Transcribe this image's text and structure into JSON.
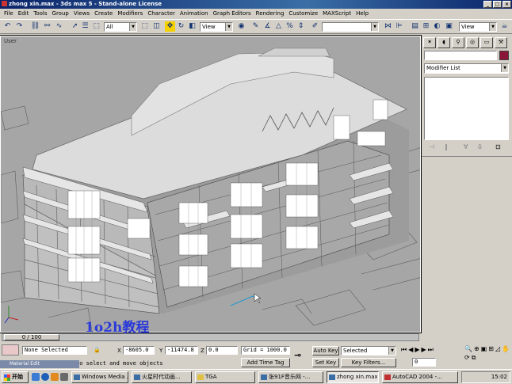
{
  "window": {
    "title": "zhong xin.max - 3ds max 5 - Stand-alone License"
  },
  "menu": [
    "File",
    "Edit",
    "Tools",
    "Group",
    "Views",
    "Create",
    "Modifiers",
    "Character",
    "Animation",
    "Graph Editors",
    "Rendering",
    "Customize",
    "MAXScript",
    "Help"
  ],
  "toolbar": {
    "selection_filter": "All",
    "ref_coord": "View",
    "named_selection": "",
    "ref_coord_right": "View"
  },
  "viewport": {
    "label": "User",
    "watermark": "1o2h教程"
  },
  "command_panel": {
    "modifier_list": "Modifier List",
    "name_field": "",
    "color": "#8b1538"
  },
  "timeslider": {
    "frame_text": "0 / 100"
  },
  "status": {
    "selection": "None Selected",
    "x_label": "X",
    "x_value": "-8605.0",
    "y_label": "Y",
    "y_value": "-11474.8",
    "z_label": "Z",
    "z_value": "0.0",
    "grid": "Grid = 1000.0",
    "prompt": "lo select and move objects",
    "add_time_tag": "Add Time Tag",
    "auto_key": "Auto Key",
    "set_key": "Set Key",
    "key_mode": "Selected",
    "key_filters": "Key Filters...",
    "frame": "0"
  },
  "material_editor": "Material Edit",
  "taskbar": {
    "start": "开始",
    "tasks": [
      "Windows Media ...",
      "火星时代动画...",
      "TGA",
      "张91F音乐网 -...",
      "zhong xin.max -...",
      "AutoCAD 2004 -..."
    ],
    "clock": "15:02"
  }
}
